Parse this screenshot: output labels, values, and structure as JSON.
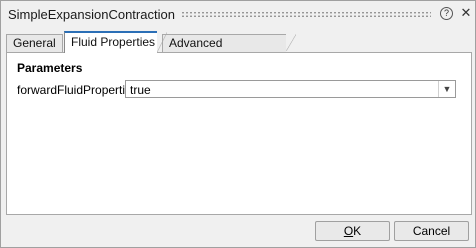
{
  "window": {
    "title": "SimpleExpansionContraction",
    "help_glyph": "?",
    "close_glyph": "✕",
    "icons": [
      "help-icon",
      "close-icon",
      "chevron-down-icon"
    ]
  },
  "tabs": [
    {
      "label": "General",
      "active": false
    },
    {
      "label": "Fluid Properties",
      "active": true
    },
    {
      "label": "Advanced Initialization",
      "active": false
    }
  ],
  "panel": {
    "section_title": "Parameters",
    "properties": [
      {
        "label": "forwardFluidProperties",
        "value": "true"
      }
    ]
  },
  "buttons": {
    "ok": {
      "mnemonic": "O",
      "rest": "K"
    },
    "cancel": {
      "label": "Cancel"
    }
  },
  "colors": {
    "active_tab_accent": "#2b6fb6",
    "background": "#f0f0f0"
  }
}
